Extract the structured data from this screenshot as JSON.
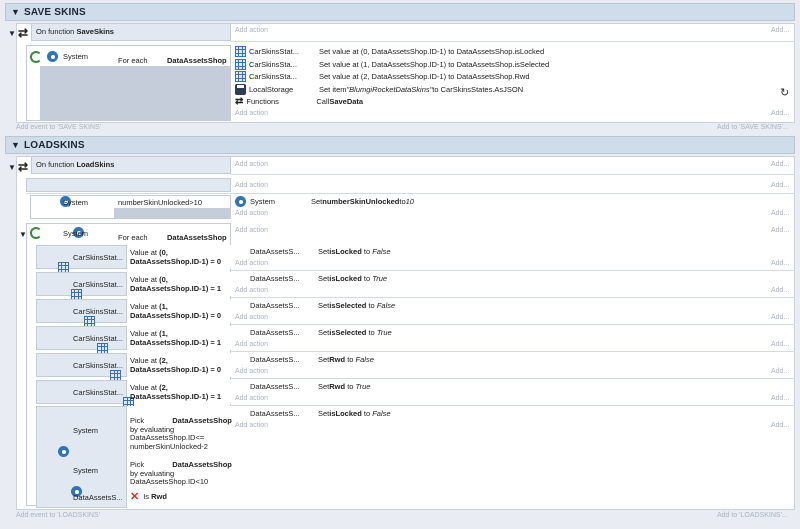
{
  "groups": [
    {
      "title": "SAVE SKINS",
      "add_event": "Add event to 'SAVE SKINS'",
      "add_to": "Add to 'SAVE SKINS'..."
    },
    {
      "title": "LOADSKINS",
      "add_event": "Add event to 'LOADSKINS'",
      "add_to": "Add to 'LOADSKINS'..."
    }
  ],
  "common": {
    "add_action": "Add action",
    "add_dots": "Add...",
    "on_function": "On function",
    "system": "System",
    "for_each": "For each",
    "pick": "Pick",
    "by_evaluating": "by evaluating",
    "value_at": "Value at",
    "is": "Is"
  },
  "save": {
    "fn_name": "SaveSkins",
    "foreach_obj": "DataAssetsShop",
    "actions": [
      {
        "obj": "CarSkinsStat...",
        "text": "Set value at (0, DataAssetsShop.ID-1) to DataAssetsShop.isLocked"
      },
      {
        "obj": "CarSkinsSta...",
        "text": "Set value at (1, DataAssetsShop.ID-1) to DataAssetsShop.isSelected"
      },
      {
        "obj": "CarSkinsSta...",
        "text": "Set value at (2, DataAssetsShop.ID-1) to DataAssetsShop.Rwd"
      },
      {
        "obj": "LocalStorage",
        "text_prefix": "Set item ",
        "text_italic": "\"BlumgiRocketDataSkins\"",
        "text_suffix": " to CarSkinsStates.AsJSON"
      },
      {
        "obj": "Functions",
        "text_prefix": "Call ",
        "text_bold": "SaveData"
      }
    ]
  },
  "load": {
    "fn_name": "LoadSkins",
    "cond_text": "numberSkinUnlocked>10",
    "set_action": {
      "obj": "System",
      "prefix": "Set ",
      "bold": "numberSkinUnlocked",
      "mid": " to ",
      "italic": "10"
    },
    "foreach_obj": "DataAssetsShop",
    "subs": [
      {
        "obj": "CarSkinsStat...",
        "idx": "0",
        "expr": "DataAssetsShop.ID-1) = 0",
        "act_obj": "DataAssetsS...",
        "act_bold": "isLocked",
        "act_val": "False"
      },
      {
        "obj": "CarSkinsStat...",
        "idx": "0",
        "expr": "DataAssetsShop.ID-1) = 1",
        "act_obj": "DataAssetsS...",
        "act_bold": "isLocked",
        "act_val": "True"
      },
      {
        "obj": "CarSkinsStat...",
        "idx": "1",
        "expr": "DataAssetsShop.ID-1) = 0",
        "act_obj": "DataAssetsS...",
        "act_bold": "isSelected",
        "act_val": "False"
      },
      {
        "obj": "CarSkinsStat...",
        "idx": "1",
        "expr": "DataAssetsShop.ID-1) = 1",
        "act_obj": "DataAssetsS...",
        "act_bold": "isSelected",
        "act_val": "True"
      },
      {
        "obj": "CarSkinsStat...",
        "idx": "2",
        "expr": "DataAssetsShop.ID-1) = 0",
        "act_obj": "DataAssetsS...",
        "act_bold": "Rwd",
        "act_val": "False"
      },
      {
        "obj": "CarSkinsStat...",
        "idx": "2",
        "expr": "DataAssetsShop.ID-1) = 1",
        "act_obj": "DataAssetsS...",
        "act_bold": "Rwd",
        "act_val": "True"
      }
    ],
    "pick1": {
      "obj": "DataAssetsShop",
      "line3": "DataAssetsShop.ID<=",
      "line4": "numberSkinUnlocked-2"
    },
    "pick2": {
      "obj": "DataAssetsShop",
      "line3": "DataAssetsShop.ID<10"
    },
    "is_cond": {
      "obj": "DataAssetsS...",
      "bold": "Rwd"
    },
    "last_action": {
      "obj": "DataAssetsS...",
      "bold": "isLocked",
      "val": "False"
    }
  }
}
